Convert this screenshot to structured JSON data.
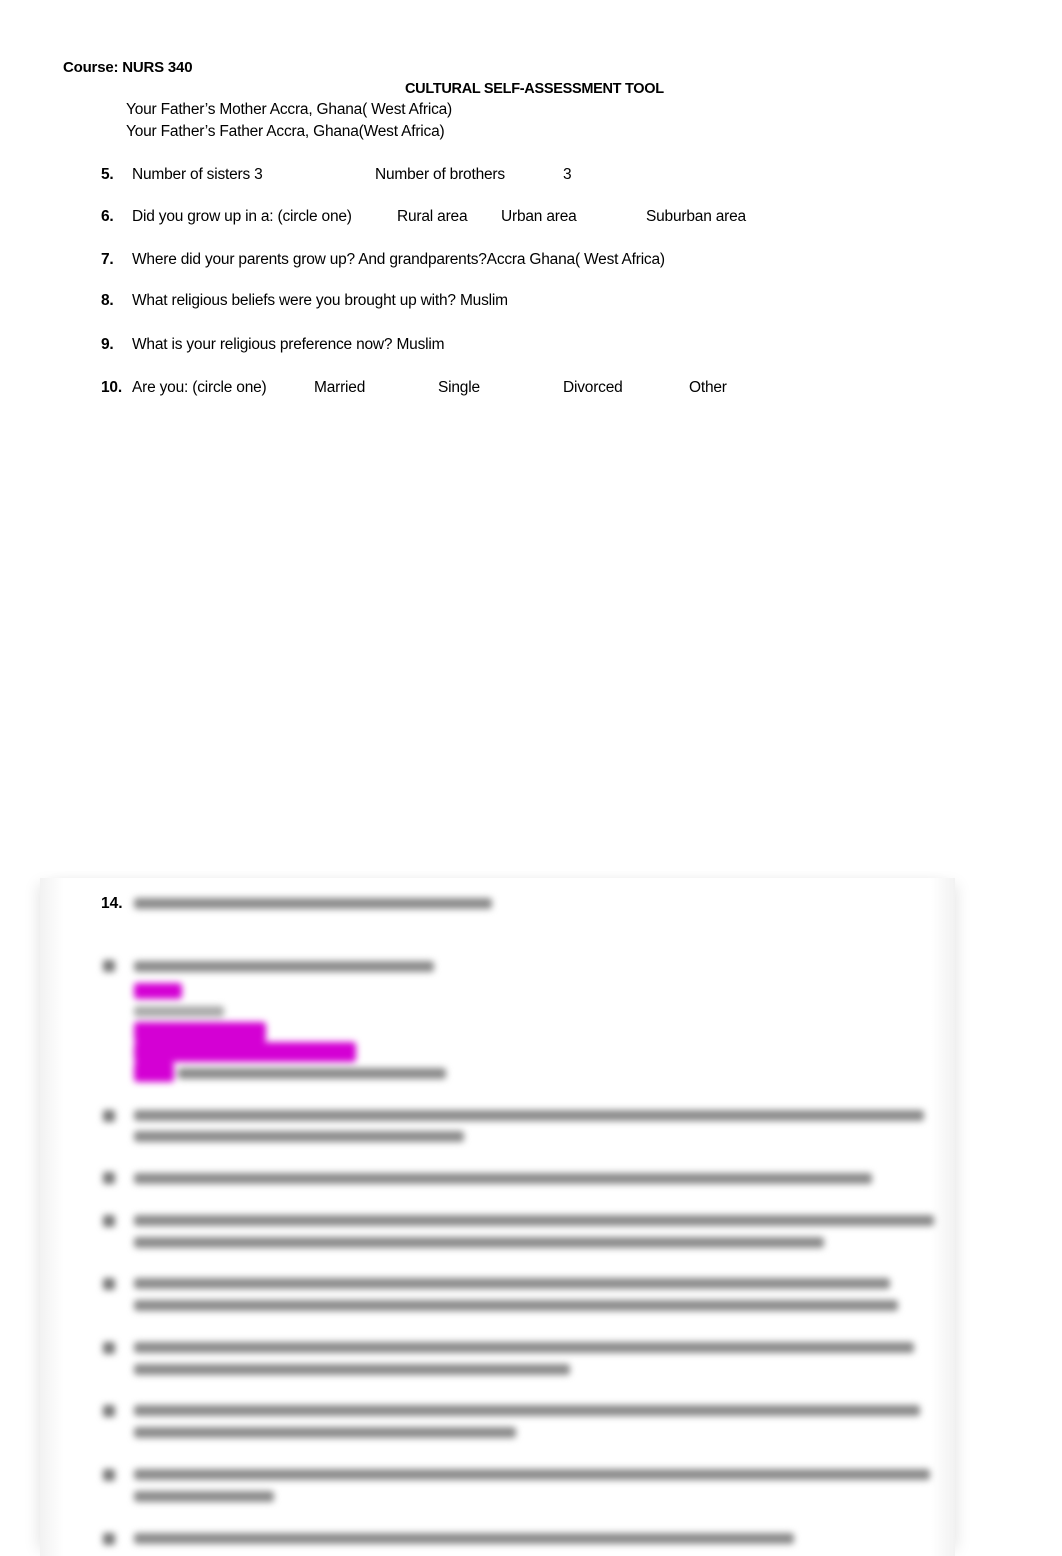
{
  "document": {
    "course": "Course: NURS 340",
    "title": "CULTURAL SELF-ASSESSMENT TOOL",
    "ancestry": [
      "Your Father’s Mother Accra, Ghana( West Africa)",
      "Your Father’s Father Accra, Ghana(West Africa)"
    ],
    "questions": [
      {
        "number": "5.",
        "text": "Number of sisters 3",
        "extra": [
          {
            "label": "Number of brothers"
          },
          {
            "label": "3"
          }
        ]
      },
      {
        "number": "6.",
        "text": "Did you grow up in a:  (circle one)",
        "options": [
          "Rural area",
          "Urban area",
          "Suburban area"
        ]
      },
      {
        "number": "7.",
        "text": "Where did your parents grow up? And grandparents?Accra Ghana( West Africa)"
      },
      {
        "number": "8.",
        "text": "What religious beliefs were you brought up with? Muslim"
      },
      {
        "number": "9.",
        "text": "What is your religious preference now? Muslim"
      },
      {
        "number": "10.",
        "text": "Are you:  (circle one)",
        "options": [
          "Married",
          "Single",
          "Divorced",
          "Other"
        ]
      }
    ]
  },
  "preview": {
    "visible_question_number": "14.",
    "highlight_color": "#d400d4",
    "blurred": true
  }
}
